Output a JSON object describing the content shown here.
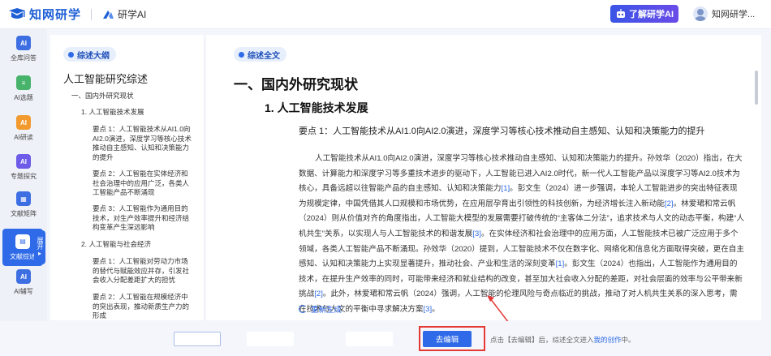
{
  "header": {
    "logo_text": "知网研学",
    "ai_brand": "研学AI",
    "learn_button": "了解研学AI",
    "user_name": "知网研学...",
    "brand_color": "#1e5fd6"
  },
  "rail": {
    "items": [
      {
        "label": "全库问答",
        "icon": "AI",
        "color": "#3d6fe3"
      },
      {
        "label": "AI选题",
        "icon": "≡",
        "color": "#48b36b"
      },
      {
        "label": "AI研读",
        "icon": "AI",
        "color": "#f29a2e"
      },
      {
        "label": "专题探究",
        "icon": "AI",
        "color": "#6c5ce7"
      },
      {
        "label": "文献矩阵",
        "icon": "▦",
        "color": "#3d6fe3"
      },
      {
        "label": "文献综述",
        "icon": "▤",
        "color": "#ffffff"
      },
      {
        "label": "AI辅写",
        "icon": "AI",
        "color": "#3d6fe3"
      }
    ],
    "expand_label": "展开"
  },
  "outline": {
    "badge": "综述大纲",
    "title": "人工智能研究综述",
    "items": [
      "一、国内外研究现状",
      "1. 人工智能技术发展",
      "要点 1：人工智能技术从AI1.0向AI2.0演进，深度学习等核心技术推动自主感知、认知和决策能力的提升",
      "要点 2：人工智能在实体经济和社会治理中的应用广泛，各类人工智能产品不断涌现",
      "要点 3：人工智能作为通用目的技术，对生产效率提升和经济结构变革产生深远影响",
      "2. 人工智能与社会经济",
      "要点 1：人工智能对劳动力市场的替代与赋能效应并存，引发社会收入分配差距扩大的担忧",
      "要点 2：人工智能在规模经济中的突出表现，推动新质生产力的形成"
    ]
  },
  "main": {
    "badge": "综述全文",
    "h1": "一、国内外研究现状",
    "h2": "1. 人工智能技术发展",
    "point": "要点 1：人工智能技术从AI1.0向AI2.0演进，深度学习等核心技术推动自主感知、认知和决策能力的提升",
    "paragraph": [
      {
        "text": "人工智能技术从AI1.0向AI2.0演进，深度学习等核心技术推动自主感知、认知和决策能力的提升。孙效华（2020）指出，在大数据、计算能力和深度学习等多重技术进步的驱动下，人工智能已进入AI2.0时代，新一代人工智能产品以深度学习等AI2.0技术为核心，具备远超以往智能产品的自主感知、认知和决策能力"
      },
      {
        "cite": "[1]"
      },
      {
        "text": "。彭文生（2024）进一步强调，本轮人工智能进步的突出特征表现为规模定律，中国凭借其人口规模和市场优势，在应用层孕育出引领性的科技创新，为经济增长注入新动能"
      },
      {
        "cite": "[2]"
      },
      {
        "text": "。林爱珺和常云帆（2024）则从价值对齐的角度指出，人工智能大模型的发展需要打破传统的“主客体二分法”，追求技术与人文的动态平衡，构建“人机共生”关系，以实现人与人工智能技术的和谐发展"
      },
      {
        "cite": "[3]"
      },
      {
        "text": "。在实体经济和社会治理中的应用方面，人工智能技术已被广泛应用于多个领域，各类人工智能产品不断涌现。孙效华（2020）提到，人工智能技术不仅在数字化、网络化和信息化方面取得突破，更在自主感知、认知和决策能力上实现显著提升，推动社会、产业和生活的深刻变革"
      },
      {
        "cite": "[1]"
      },
      {
        "text": "。彭文生（2024）也指出，人工智能作为通用目的技术，在提升生产效率的同时，可能带来经济和就业结构的改变，甚至加大社会收入分配的差距，对社会层面的效率与公平带来新挑战"
      },
      {
        "cite": "[2]"
      },
      {
        "text": "。此外，林爱珺和常云帆（2024）强调，人工智能的伦理风险与奇点临近的挑战，推动了对人机共生关系的深入思考，需在技术与人文的平衡中寻求解决方案"
      },
      {
        "cite": "[3]"
      },
      {
        "text": "。"
      }
    ],
    "regen": "重新生成"
  },
  "bottom": {
    "edit_button": "去编辑",
    "hint_prefix": "点击【去编辑】后，综述全文进入",
    "hint_link": "我的创作",
    "hint_suffix": "中。"
  }
}
